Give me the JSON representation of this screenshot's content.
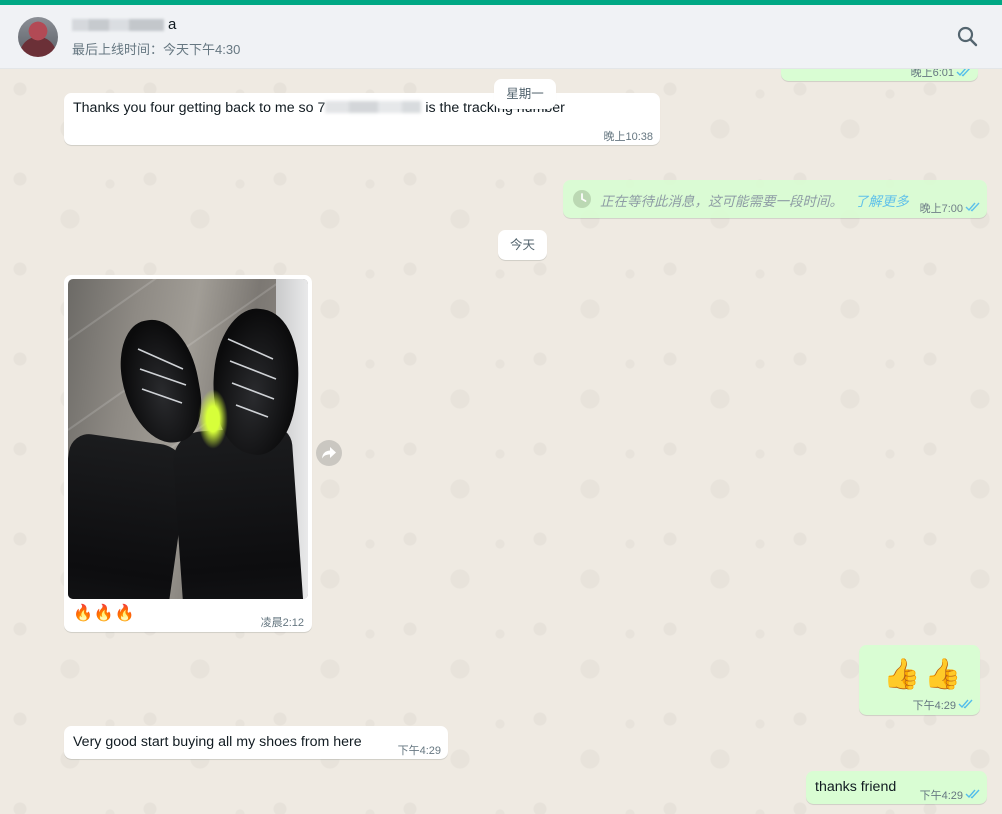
{
  "header": {
    "contact_name_tail": "a",
    "last_seen": "最后上线时间：今天下午4:30"
  },
  "icons": {
    "search": "search-icon",
    "forward": "forward-icon",
    "clock": "clock-icon",
    "ticks": "double-check-icon"
  },
  "colors": {
    "accent": "#00a884",
    "incoming_bubble": "#ffffff",
    "outgoing_bubble": "#d9fdd3",
    "read_ticks": "#53bdeb"
  },
  "messages": {
    "top_partial": {
      "time": "晚上6:01"
    },
    "date_monday": "星期一",
    "tracking": {
      "text_before": "Thanks you four getting back to me so 7",
      "text_after": " is the tracking number",
      "time": "晚上10:38"
    },
    "waiting": {
      "text": "正在等待此消息，这可能需要一段时间。",
      "link": "了解更多",
      "time": "晚上7:00"
    },
    "date_today": "今天",
    "photo": {
      "caption": "🔥🔥🔥",
      "time": "凌晨2:12"
    },
    "thumbs": {
      "text": "👍👍",
      "time": "下午4:29"
    },
    "very_good": {
      "text": "Very good start buying all my shoes from here",
      "time": "下午4:29"
    },
    "thanks": {
      "text": "thanks friend",
      "time": "下午4:29"
    }
  }
}
